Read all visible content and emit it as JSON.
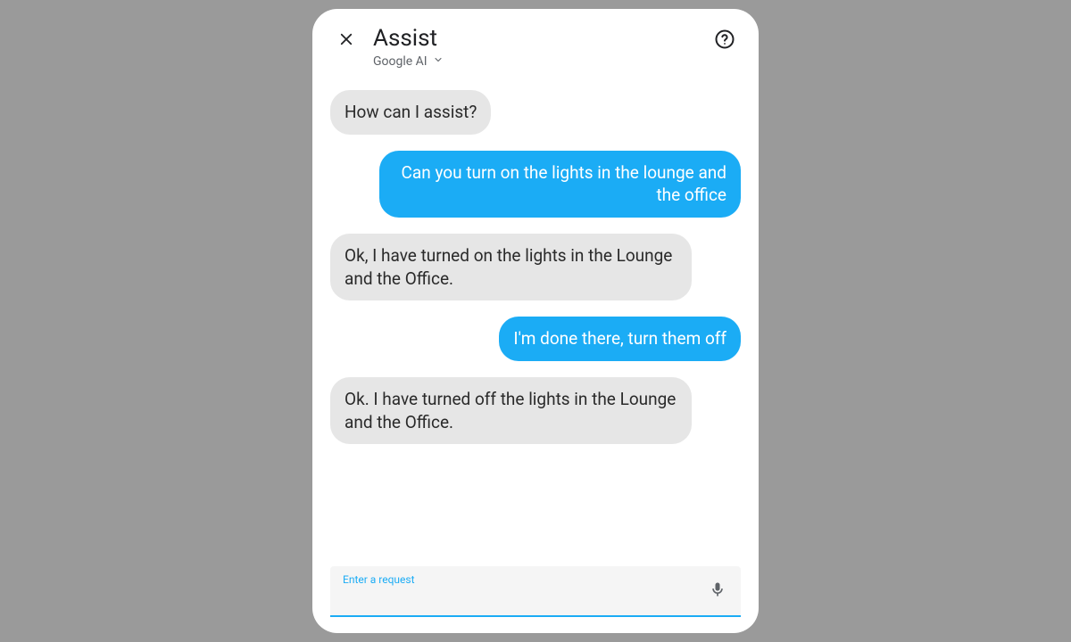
{
  "header": {
    "title": "Assist",
    "provider": "Google AI"
  },
  "messages": [
    {
      "role": "assistant",
      "text": "How can I assist?"
    },
    {
      "role": "user",
      "text": "Can you turn on the lights in the lounge and the office"
    },
    {
      "role": "assistant",
      "text": "Ok, I have turned on the lights in the Lounge and the Office."
    },
    {
      "role": "user",
      "text": "I'm done there, turn them off"
    },
    {
      "role": "assistant",
      "text": "Ok. I have turned off the lights in the Lounge and the Office."
    }
  ],
  "input": {
    "label": "Enter a request",
    "value": ""
  },
  "colors": {
    "accent": "#1bacf5",
    "assistant_bubble": "#e6e6e6",
    "user_bubble": "#1bacf5"
  }
}
